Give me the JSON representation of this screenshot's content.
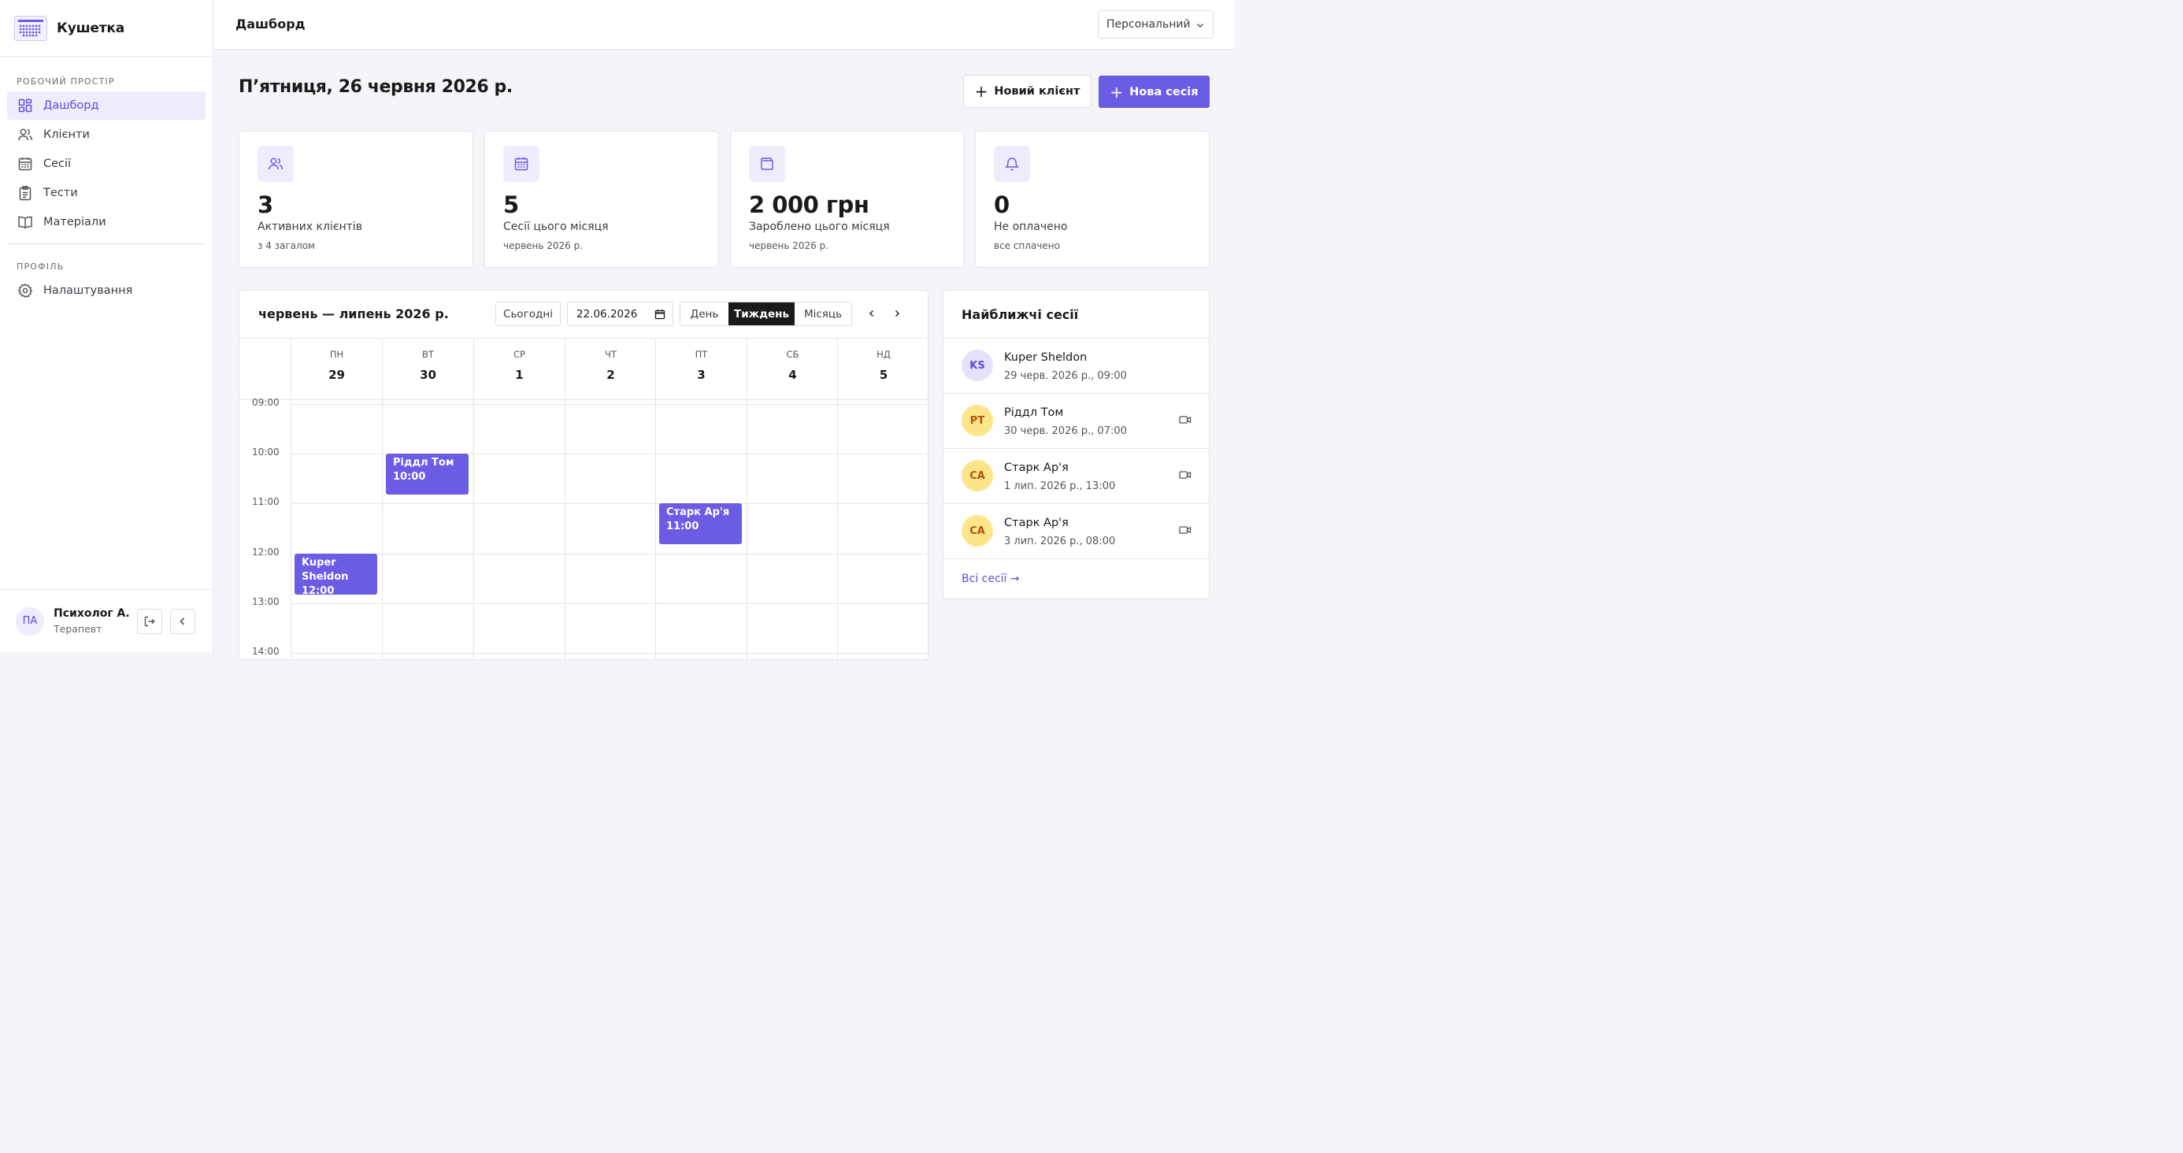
{
  "brand": {
    "name": "Кушетка"
  },
  "sidebar": {
    "workspace_label": "РОБОЧИЙ ПРОСТІР",
    "items": [
      {
        "label": "Дашборд",
        "icon": "dashboard-icon",
        "active": true
      },
      {
        "label": "Клієнти",
        "icon": "users-icon"
      },
      {
        "label": "Сесії",
        "icon": "calendar-icon"
      },
      {
        "label": "Тести",
        "icon": "clipboard-icon"
      },
      {
        "label": "Матеріали",
        "icon": "book-icon"
      }
    ],
    "profile_label": "ПРОФІЛЬ",
    "settings_label": "Налаштування"
  },
  "user": {
    "initials": "ПА",
    "name": "Психолог А...",
    "role": "Терапевт"
  },
  "header": {
    "title": "Дашборд",
    "workspace": "Персональний"
  },
  "main": {
    "date_title": "П’ятниця, 26 червня 2026 р.",
    "new_client_label": "Новий клієнт",
    "new_session_label": "Нова сесія"
  },
  "stats": [
    {
      "value": "3",
      "label": "Активних клієнтів",
      "sub": "з 4 загалом",
      "icon": "users-icon"
    },
    {
      "value": "5",
      "label": "Сесії цього місяця",
      "sub": "червень 2026 р.",
      "icon": "calendar-icon"
    },
    {
      "value": "2 000 грн",
      "label": "Зароблено цього місяця",
      "sub": "червень 2026 р.",
      "icon": "wallet-icon"
    },
    {
      "value": "0",
      "label": "Не оплачено",
      "sub": "все сплачено",
      "icon": "bell-icon"
    }
  ],
  "calendar": {
    "range": "червень — липень 2026 р.",
    "today_label": "Сьогодні",
    "date_value": "22.06.2026",
    "views": [
      "День",
      "Тиждень",
      "Місяць"
    ],
    "active_view": "Тиждень",
    "days": [
      {
        "name": "ПН",
        "num": "29"
      },
      {
        "name": "ВТ",
        "num": "30"
      },
      {
        "name": "СР",
        "num": "1"
      },
      {
        "name": "ЧТ",
        "num": "2"
      },
      {
        "name": "ПТ",
        "num": "3"
      },
      {
        "name": "СБ",
        "num": "4"
      },
      {
        "name": "НД",
        "num": "5"
      }
    ],
    "times": [
      "09:00",
      "10:00",
      "11:00",
      "12:00",
      "13:00",
      "14:00"
    ],
    "events": [
      {
        "title": "Ріддл Том",
        "time": "10:00"
      },
      {
        "title": "Старк Ар'я",
        "time": "11:00"
      },
      {
        "title": "Kuper Sheldon",
        "time": "12:00"
      }
    ]
  },
  "upcoming": {
    "title": "Найближчі сесії",
    "items": [
      {
        "initials": "KS",
        "name": "Kuper Sheldon",
        "time": "29 черв. 2026 р., 09:00",
        "video": false,
        "bg": "#e6e1fb",
        "fg": "#5b4cdb"
      },
      {
        "initials": "РТ",
        "name": "Ріддл Том",
        "time": "30 черв. 2026 р., 07:00",
        "video": true,
        "bg": "#fde68a",
        "fg": "#b45309"
      },
      {
        "initials": "СА",
        "name": "Старк Ар'я",
        "time": "1 лип. 2026 р., 13:00",
        "video": true,
        "bg": "#fde68a",
        "fg": "#b45309"
      },
      {
        "initials": "СА",
        "name": "Старк Ар'я",
        "time": "3 лип. 2026 р., 08:00",
        "video": true,
        "bg": "#fde68a",
        "fg": "#b45309"
      }
    ],
    "all_link": "Всі сесії →"
  },
  "colors": {
    "accent": "#6b5ce6",
    "accent_soft": "#eeecfd"
  }
}
